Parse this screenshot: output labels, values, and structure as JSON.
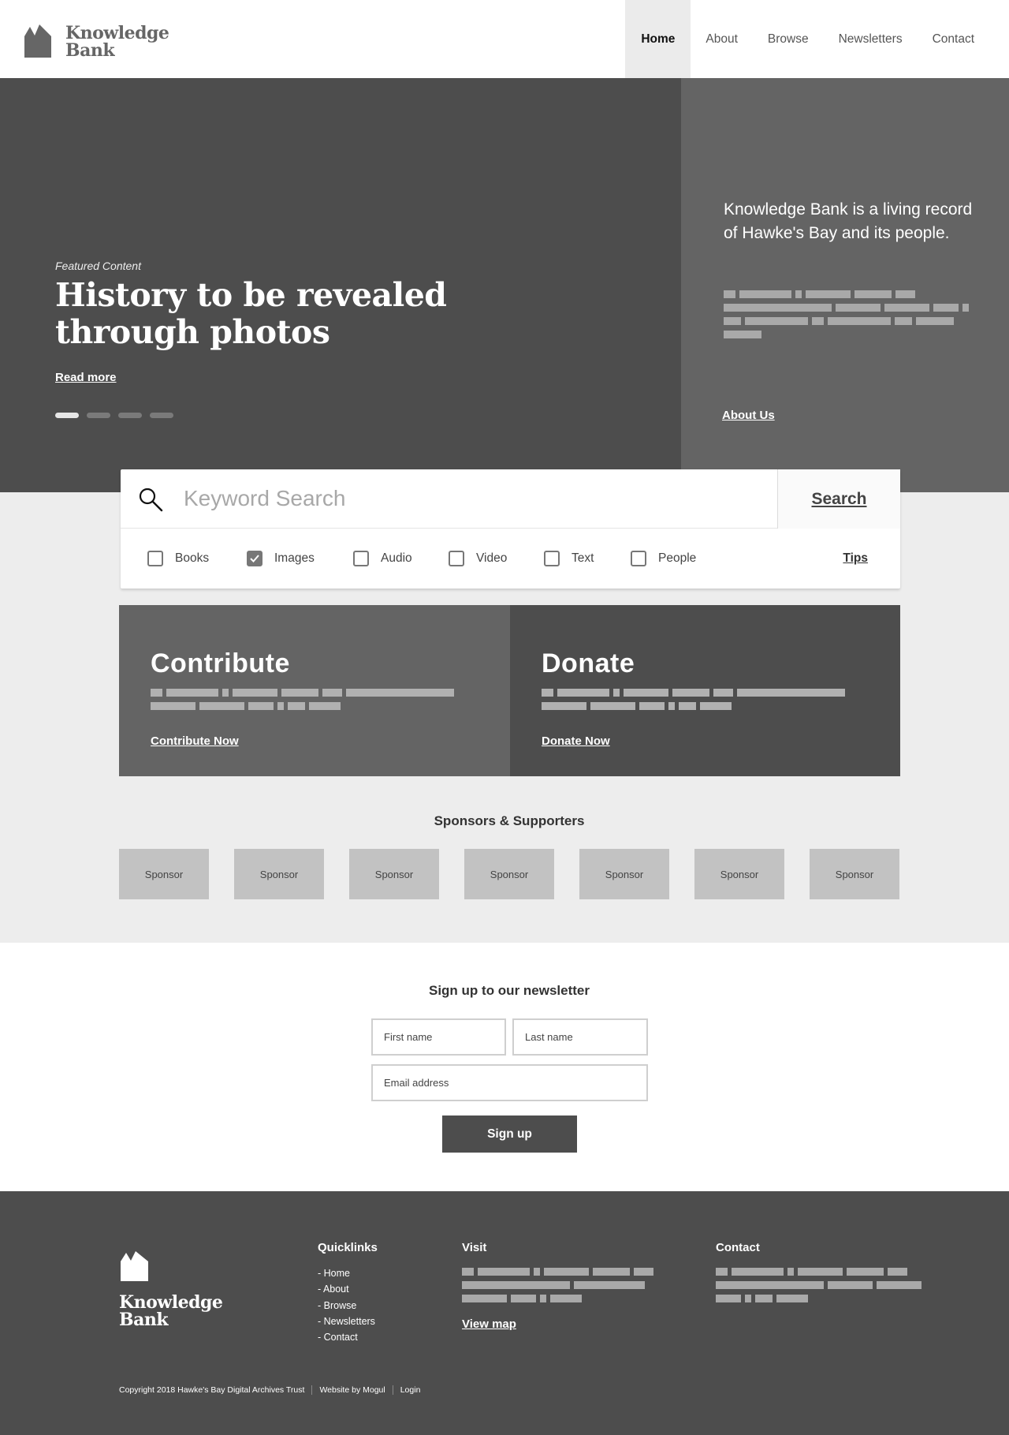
{
  "header": {
    "logo_text_line1": "Knowledge",
    "logo_text_line2": "Bank",
    "nav": [
      {
        "label": "Home",
        "active": true
      },
      {
        "label": "About"
      },
      {
        "label": "Browse"
      },
      {
        "label": "Newsletters"
      },
      {
        "label": "Contact"
      }
    ]
  },
  "hero": {
    "featured_label": "Featured Content",
    "title": "History to be revealed through photos",
    "read_more": "Read more",
    "slides": 4,
    "active_slide": 1,
    "side_text": "Knowledge Bank is a living record of Hawke's Bay and its people.",
    "about_link": "About Us"
  },
  "search": {
    "placeholder": "Keyword Search",
    "button_label": "Search",
    "filters": [
      {
        "label": "Books",
        "checked": false
      },
      {
        "label": "Images",
        "checked": true
      },
      {
        "label": "Audio",
        "checked": false
      },
      {
        "label": "Video",
        "checked": false
      },
      {
        "label": "Text",
        "checked": false
      },
      {
        "label": "People",
        "checked": false
      }
    ],
    "tips_label": "Tips"
  },
  "cta": {
    "contribute": {
      "title": "Contribute",
      "link": "Contribute Now"
    },
    "donate": {
      "title": "Donate",
      "link": "Donate Now"
    }
  },
  "sponsors": {
    "title": "Sponsors & Supporters",
    "items": [
      "Sponsor",
      "Sponsor",
      "Sponsor",
      "Sponsor",
      "Sponsor",
      "Sponsor",
      "Sponsor"
    ]
  },
  "newsletter": {
    "title": "Sign up to our newsletter",
    "first_name_placeholder": "First name",
    "last_name_placeholder": "Last name",
    "email_placeholder": "Email address",
    "submit_label": "Sign up"
  },
  "footer": {
    "logo_text_line1": "Knowledge",
    "logo_text_line2": "Bank",
    "quicklinks_title": "Quicklinks",
    "quicklinks": [
      "- Home",
      "- About",
      "- Browse",
      "- Newsletters",
      "- Contact"
    ],
    "visit_title": "Visit",
    "view_map": "View map",
    "contact_title": "Contact",
    "copyright": "Copyright  2018 Hawke's Bay Digital Archives Trust",
    "website_by": "Website by Mogul",
    "login": "Login"
  },
  "colors": {
    "dark_panel": "#4d4d4d",
    "mid_panel": "#646464",
    "light_bg": "#ededed",
    "placeholder_bar": "#a9a9a9",
    "sponsor_box": "#c2c2c2"
  }
}
